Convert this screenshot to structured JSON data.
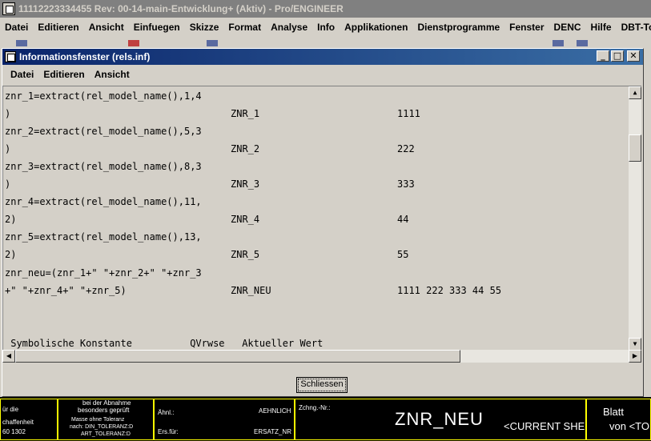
{
  "app": {
    "title": "11112223334455 Rev: 00-14-main-Entwicklung+ (Aktiv) - Pro/ENGINEER",
    "menu": [
      "Datei",
      "Editieren",
      "Ansicht",
      "Einfuegen",
      "Skizze",
      "Format",
      "Analyse",
      "Info",
      "Applikationen",
      "Dienstprogramme",
      "Fenster",
      "DENC",
      "Hilfe",
      "DBT-Tools"
    ]
  },
  "dialog": {
    "title": "Informationsfenster (rels.inf)",
    "buttons": {
      "minimize": "_",
      "maximize": "□",
      "close": "✕"
    },
    "menu": [
      "Datei",
      "Editieren",
      "Ansicht"
    ],
    "lines": [
      {
        "a": "znr_1=extract(rel_model_name(),1,4",
        "b": "",
        "c": ""
      },
      {
        "a": ")",
        "b": "ZNR_1",
        "c": "1111"
      },
      {
        "a": "znr_2=extract(rel_model_name(),5,3",
        "b": "",
        "c": ""
      },
      {
        "a": ")",
        "b": "ZNR_2",
        "c": "222"
      },
      {
        "a": "znr_3=extract(rel_model_name(),8,3",
        "b": "",
        "c": ""
      },
      {
        "a": ")",
        "b": "ZNR_3",
        "c": "333"
      },
      {
        "a": "znr_4=extract(rel_model_name(),11,",
        "b": "",
        "c": ""
      },
      {
        "a": "2)",
        "b": "ZNR_4",
        "c": "44"
      },
      {
        "a": "znr_5=extract(rel_model_name(),13,",
        "b": "",
        "c": ""
      },
      {
        "a": "2)",
        "b": "ZNR_5",
        "c": "55"
      },
      {
        "a": "znr_neu=(znr_1+\" \"+znr_2+\" \"+znr_3",
        "b": "",
        "c": ""
      },
      {
        "a": "+\" \"+znr_4+\" \"+znr_5)",
        "b": "ZNR_NEU",
        "c": "1111 222 333 44 55"
      }
    ],
    "header_row": " Symbolische Konstante          QVrwse   Aktueller Wert",
    "close_label": "Schliessen"
  },
  "titleblock": {
    "c1a": "ür die",
    "c1b": "chaffenheit",
    "c1c": "60 1302",
    "c2a": "bei der Abnahme",
    "c2b": "besonders geprüft",
    "c2c": "Masse ohne Toleranz",
    "c2d": "nach: DIN_TOLERANZ:D",
    "c2e": "ART_TOLERANZ:D",
    "c3a": "Ähnl.:",
    "c3b": "AEHNLICH",
    "c3c": "Ers.für:",
    "c3d": "ERSATZ_NR",
    "c4a": "Zchng.-Nr.:",
    "c4b": "ZNR_NEU",
    "c4c": "<CURRENT SHEET>",
    "c5a": "Blatt",
    "c5b": "von <TO"
  },
  "colors": {
    "titlebar_active": "#0a246a",
    "cad_lines": "#ffff00",
    "cad_bg": "#000000"
  }
}
